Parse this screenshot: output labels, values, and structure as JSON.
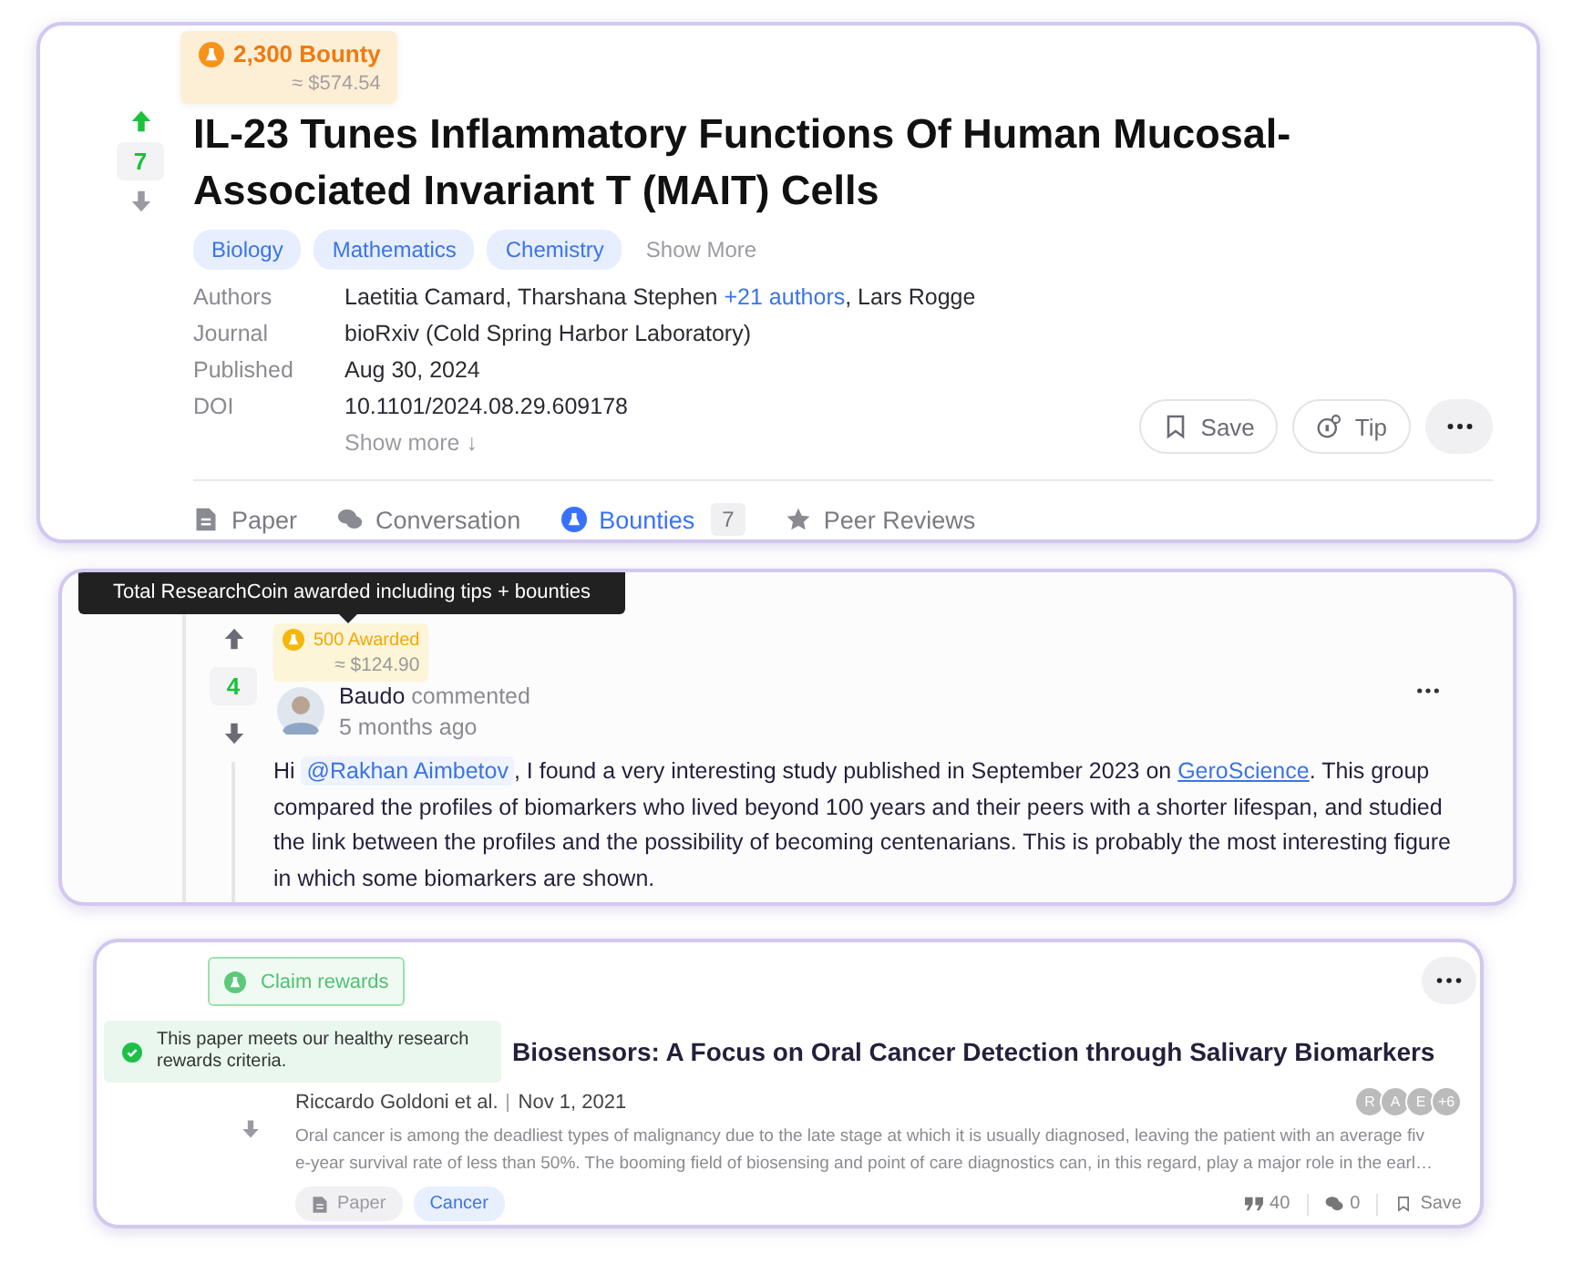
{
  "paper": {
    "bounty": {
      "amount": "2,300 Bounty",
      "usd": "≈ $574.54"
    },
    "votes": {
      "count": "7",
      "upvoted": true
    },
    "title": "IL-23 Tunes Inflammatory Functions Of Human Mucosal-Associated Invariant T (MAIT) Cells",
    "tags": [
      "Biology",
      "Mathematics",
      "Chemistry"
    ],
    "show_more_tags": "Show More",
    "meta": [
      {
        "label": "Authors",
        "parts": [
          {
            "kind": "text",
            "text": "Laetitia Camard, Tharshana Stephen "
          },
          {
            "kind": "link",
            "text": "+21 authors"
          },
          {
            "kind": "text",
            "text": ", Lars Rogge"
          }
        ]
      },
      {
        "label": "Journal",
        "parts": [
          {
            "kind": "text",
            "text": "bioRxiv (Cold Spring Harbor Laboratory)"
          }
        ]
      },
      {
        "label": "Published",
        "parts": [
          {
            "kind": "text",
            "text": "Aug 30, 2024"
          }
        ]
      },
      {
        "label": "DOI",
        "parts": [
          {
            "kind": "text",
            "text": "10.1101/2024.08.29.609178"
          }
        ]
      }
    ],
    "show_more": "Show more ↓",
    "actions": [
      {
        "kind": "save",
        "label": "Save"
      },
      {
        "kind": "tip",
        "label": "Tip"
      },
      {
        "kind": "more"
      }
    ],
    "tabs": [
      {
        "kind": "paper",
        "label": "Paper",
        "selected": false
      },
      {
        "kind": "conversation",
        "label": "Conversation",
        "selected": false
      },
      {
        "kind": "bounties",
        "label": "Bounties",
        "count": "7",
        "selected": true
      },
      {
        "kind": "reviews",
        "label": "Peer Reviews",
        "selected": false
      }
    ]
  },
  "comment": {
    "tooltip": "Total ResearchCoin awarded including tips + bounties",
    "award": {
      "amount": "500 Awarded",
      "usd": "≈ $124.90"
    },
    "votes": {
      "count": "4",
      "upvoted": false
    },
    "author": "Baudo",
    "action": "commented",
    "time": "5 months ago",
    "body": [
      {
        "kind": "text",
        "text": "Hi "
      },
      {
        "kind": "mention",
        "text": "@Rakhan Aimbetov"
      },
      {
        "kind": "text",
        "text": ", I found a very interesting study published in September 2023 on "
      },
      {
        "kind": "link",
        "text": "GeroScience"
      },
      {
        "kind": "text",
        "text": ". This group compared the profiles of biomarkers who lived beyond 100 years and their peers with a shorter lifespan, and studied the link between the profiles and the possibility of becoming centenarians. This is probably the most interesting figure in which some biomarkers are shown."
      }
    ]
  },
  "related": {
    "claim_button": "Claim rewards",
    "toast": "This paper meets our healthy research rewards criteria.",
    "title": "Biosensors: A Focus on Oral Cancer Detection through Salivary Biomarkers",
    "authors": "Riccardo Goldoni et al.",
    "date": "Nov 1, 2021",
    "avatars": [
      "R",
      "A",
      "E",
      "+6"
    ],
    "abstract": [
      "Oral cancer is among the deadliest types of malignancy due to the late stage at which it is usually diagnosed, leaving the patient with an average fiv",
      "e-year survival rate of less than 50%. The booming field of biosensing and point of care diagnostics can, in this regard, play a major role in the earl…"
    ],
    "chips": [
      {
        "kind": "type",
        "label": "Paper"
      },
      {
        "kind": "tag",
        "label": "Cancer"
      }
    ],
    "citations": "40",
    "comments": "0",
    "save": "Save"
  }
}
